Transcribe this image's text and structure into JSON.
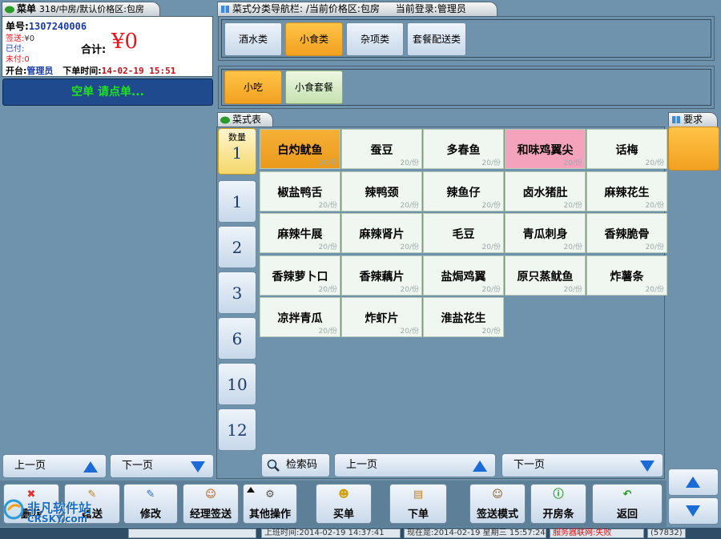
{
  "order": {
    "tab_label": "菜单",
    "tab_info": "318/中房/默认价格区:包房",
    "order_no_label": "单号:",
    "order_no": "1307240006",
    "signed_label": "签送:",
    "signed_value": "¥0",
    "paid_label": "已付:",
    "unpaid_label": "未付:",
    "unpaid_value": "0",
    "total_label": "合计:",
    "total_value": "¥0",
    "opener_label": "开台:",
    "opener_value": "管理员",
    "time_label": "下单时间:",
    "time_value": "14-02-19 15:51",
    "empty_msg": "空单 请点单..."
  },
  "left_paging": {
    "prev": "上一页",
    "next": "下一页"
  },
  "nav": {
    "label": "菜式分类导航栏:",
    "price_zone": "/当前价格区:包房",
    "login": "当前登录:管理员",
    "categories": [
      "酒水类",
      "小食类",
      "杂项类",
      "套餐配送类"
    ],
    "subcategories": [
      "小吃",
      "小食套餐"
    ]
  },
  "menu_tab": "菜式表",
  "requirement_tab": "要求",
  "qty": {
    "label": "数量",
    "current": "1",
    "options": [
      "1",
      "2",
      "3",
      "6",
      "10",
      "12"
    ]
  },
  "dishes": [
    {
      "name": "白灼鱿鱼",
      "price": "20/份"
    },
    {
      "name": "蚕豆",
      "price": "20/份"
    },
    {
      "name": "多春鱼",
      "price": "20/份"
    },
    {
      "name": "和味鸡翼尖",
      "price": "20/份"
    },
    {
      "name": "话梅",
      "price": "20/份"
    },
    {
      "name": "椒盐鸭舌",
      "price": "20/份"
    },
    {
      "name": "辣鸭颈",
      "price": "20/份"
    },
    {
      "name": "辣鱼仔",
      "price": "20/份"
    },
    {
      "name": "卤水猪肚",
      "price": "20/份"
    },
    {
      "name": "麻辣花生",
      "price": "20/份"
    },
    {
      "name": "麻辣牛展",
      "price": "20/份"
    },
    {
      "name": "麻辣肾片",
      "price": "20/份"
    },
    {
      "name": "毛豆",
      "price": "20/份"
    },
    {
      "name": "青瓜刺身",
      "price": "20/份"
    },
    {
      "name": "香辣脆骨",
      "price": "20/份"
    },
    {
      "name": "香辣萝卜口",
      "price": "20/份"
    },
    {
      "name": "香辣藕片",
      "price": "20/份"
    },
    {
      "name": "盐焗鸡翼",
      "price": "20/份"
    },
    {
      "name": "原只蒸鱿鱼",
      "price": "20/份"
    },
    {
      "name": "炸薯条",
      "price": "20/份"
    },
    {
      "name": "凉拌青瓜",
      "price": "20/份"
    },
    {
      "name": "炸虾片",
      "price": "20/份"
    },
    {
      "name": "淮盐花生",
      "price": "20/份"
    }
  ],
  "menu_paging": {
    "search": "检索码",
    "prev": "上一页",
    "next": "下一页"
  },
  "toolbar": {
    "delete": "删除",
    "send": "赠送",
    "modify": "修改",
    "manager_sign": "经理签送",
    "other_ops": "其他操作",
    "checkout": "买单",
    "place_order": "下单",
    "sign_mode": "签送模式",
    "room_slip": "开房条",
    "back": "返回"
  },
  "status": {
    "shift_time": "上班时间:2014-02-19 14:37:41",
    "now_time": "现在是:2014-02-19 星期三 15:57:24",
    "conn_status": "服务器联网:失败",
    "code": "(57832)"
  },
  "watermark": {
    "brand": "非凡软件站",
    "site": "CRSKY.com"
  },
  "colors": {
    "background": "#6f93ad",
    "accent_orange": "#f2a020",
    "total_red": "#e8141c",
    "message_green": "#1fe01f"
  }
}
